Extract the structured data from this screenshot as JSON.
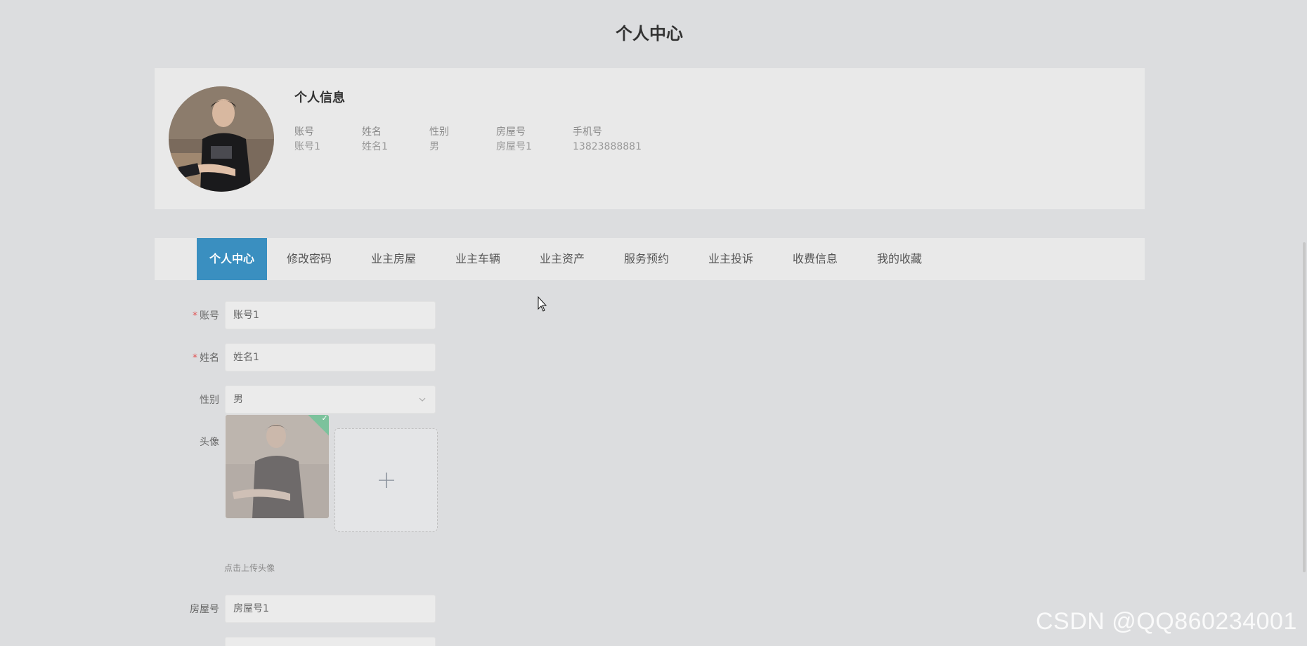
{
  "page": {
    "title": "个人中心"
  },
  "profile": {
    "heading": "个人信息",
    "fields": [
      {
        "label": "账号",
        "value": "账号1"
      },
      {
        "label": "姓名",
        "value": "姓名1"
      },
      {
        "label": "性别",
        "value": "男"
      },
      {
        "label": "房屋号",
        "value": "房屋号1"
      },
      {
        "label": "手机号",
        "value": "13823888881"
      }
    ]
  },
  "tabs": [
    {
      "label": "个人中心",
      "active": true
    },
    {
      "label": "修改密码",
      "active": false
    },
    {
      "label": "业主房屋",
      "active": false
    },
    {
      "label": "业主车辆",
      "active": false
    },
    {
      "label": "业主资产",
      "active": false
    },
    {
      "label": "服务预约",
      "active": false
    },
    {
      "label": "业主投诉",
      "active": false
    },
    {
      "label": "收费信息",
      "active": false
    },
    {
      "label": "我的收藏",
      "active": false
    }
  ],
  "form": {
    "account": {
      "label": "账号",
      "required": "*",
      "value": "账号1"
    },
    "name": {
      "label": "姓名",
      "required": "*",
      "value": "姓名1"
    },
    "gender": {
      "label": "性别",
      "value": "男"
    },
    "avatar": {
      "label": "头像",
      "hint": "点击上传头像"
    },
    "house": {
      "label": "房屋号",
      "value": "房屋号1"
    }
  },
  "watermark": "CSDN @QQ860234001",
  "colors": {
    "accent": "#3a8fc0",
    "required": "#e05050",
    "success": "#7cc29c"
  }
}
